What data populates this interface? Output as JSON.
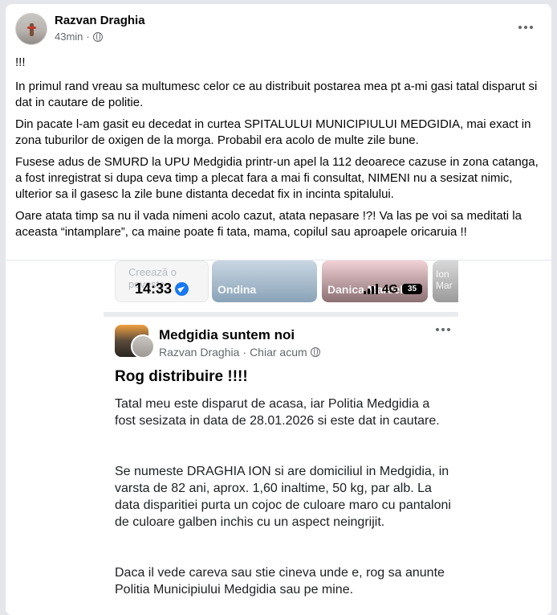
{
  "post": {
    "author": "Razvan Draghia",
    "time": "43min",
    "separator": "·",
    "paragraphs": [
      "!!!",
      "In primul rand vreau sa multumesc celor ce au distribuit postarea mea pt a-mi gasi tatal disparut si dat in cautare de politie.",
      "Din pacate l-am gasit eu decedat in curtea SPITALULUI MUNICIPIULUI MEDGIDIA, mai exact in zona tuburilor de oxigen de la morga. Probabil era acolo de multe zile bune.",
      "Fusese adus de SMURD la UPU Medgidia printr-un apel la 112 deoarece cazuse in zona catanga, a fost inregistrat si dupa ceva timp a plecat fara a mai fi consultat, NIMENI nu a sesizat nimic, ulterior sa il gasesc la zile bune distanta decedat fix in incinta spitalului.",
      "Oare atata timp sa nu il vada nimeni acolo cazut, atata nepasare !?! Va las pe voi sa meditati la aceasta “intamplare”, ca maine poate fi tata, mama, copilul sau aproapele oricaruia !!"
    ]
  },
  "screenshot": {
    "stories": [
      {
        "label": "Creează o poveste"
      },
      {
        "label": "Ondina"
      },
      {
        "label": "Danica Marcel"
      },
      {
        "label": "Ion Mar"
      }
    ],
    "status": {
      "time": "14:33",
      "network": "4G",
      "battery": "35"
    },
    "group_name": "Medgidia suntem noi",
    "author": "Razvan Draghia",
    "separator": "·",
    "time": "Chiar acum",
    "title": "Rog distribuire !!!!",
    "paragraphs": [
      "Tatal meu este disparut de acasa, iar Politia Medgidia a fost sesizata in data de 28.01.2026 si este dat in cautare.",
      "Se numeste DRAGHIA ION si are domiciliul in Medgidia, in varsta de 82 ani, aprox. 1,60 inaltime, 50 kg, par alb. La data disparitiei purta un cojoc de culoare maro cu pantaloni de culoare galben inchis cu un aspect neingrijit.",
      "Daca il vede careva sau stie cineva unde e, rog sa anunte Politia Municipiului Medgidia sau pe mine."
    ]
  },
  "colors": {
    "accent": "#1877f2",
    "meta_text": "#65676b",
    "background": "#e4e6eb"
  }
}
